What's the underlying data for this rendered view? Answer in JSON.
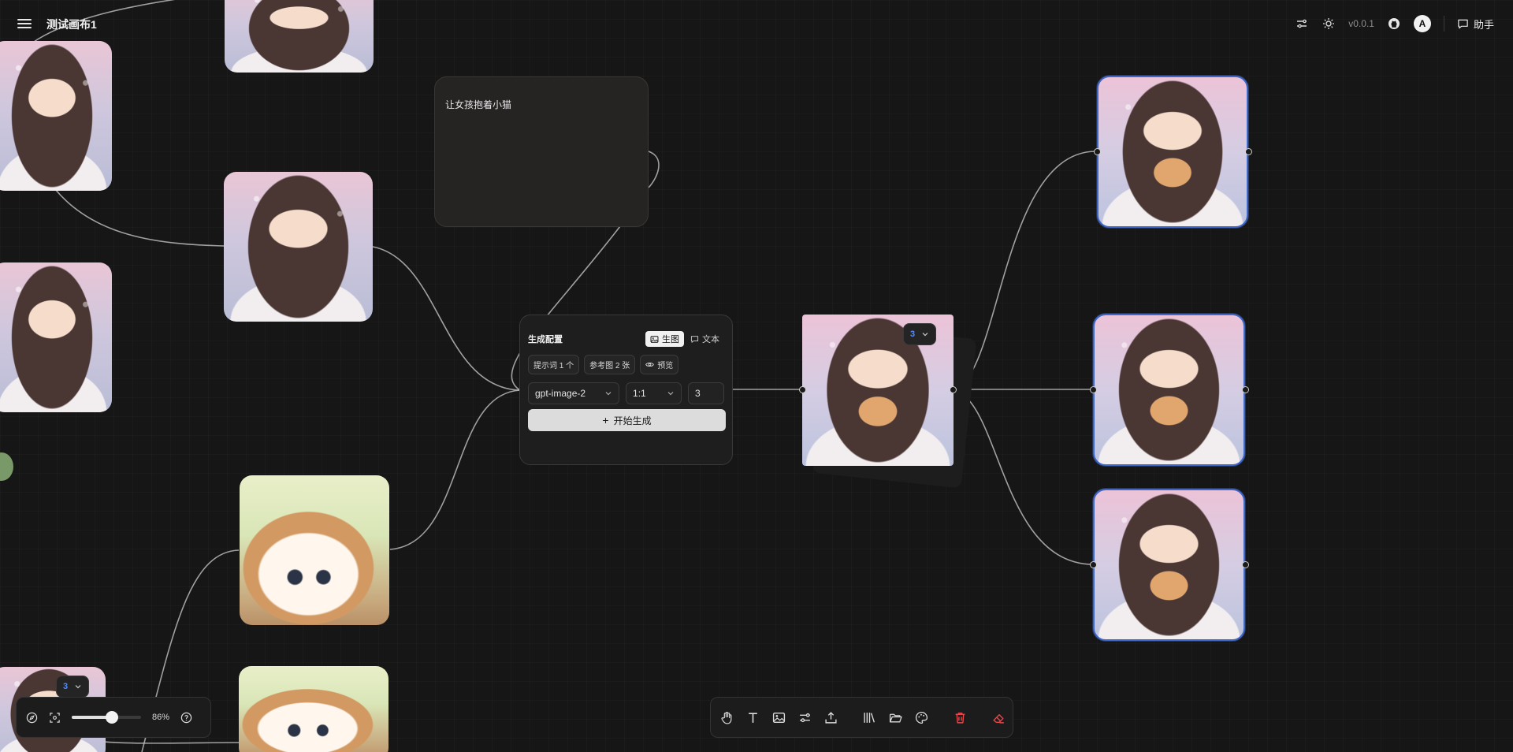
{
  "app": {
    "canvas_title": "测试画布1",
    "version": "v0.0.1",
    "avatar_letter": "A",
    "assistant_label": "助手"
  },
  "prompt_node": {
    "text": "让女孩抱着小猫"
  },
  "generate_node": {
    "title": "生成配置",
    "mode_tabs": [
      {
        "label": "生图",
        "icon": "image-icon",
        "active": true
      },
      {
        "label": "文本",
        "icon": "message-icon",
        "active": false
      }
    ],
    "chips": {
      "prompt_count": "提示词 1 个",
      "reference_count": "参考图 2 张",
      "preview": "预览"
    },
    "model": "gpt-image-2",
    "aspect_ratio": "1:1",
    "count": "3",
    "start_label": "开始生成"
  },
  "badges": {
    "output_count": "3",
    "bottom_count": "3"
  },
  "zoom": {
    "value_label": "86%",
    "level": 0.86
  },
  "colors": {
    "background": "#161616",
    "accent_selected": "#3f67c6",
    "badge_number": "#4f8cff",
    "delete_red": "#e5484d"
  },
  "icons": {
    "topbar": [
      "settings-sliders-icon",
      "sun-icon",
      "github-icon",
      "message-square-icon"
    ],
    "zoom_bar": [
      "compass-icon",
      "fit-screen-icon",
      "help-icon"
    ],
    "toolbar": [
      "hand-icon",
      "text-icon",
      "image-icon",
      "connect-icon",
      "upload-icon",
      "library-icon",
      "folder-icon",
      "palette-icon",
      "trash-icon",
      "eraser-icon"
    ]
  }
}
